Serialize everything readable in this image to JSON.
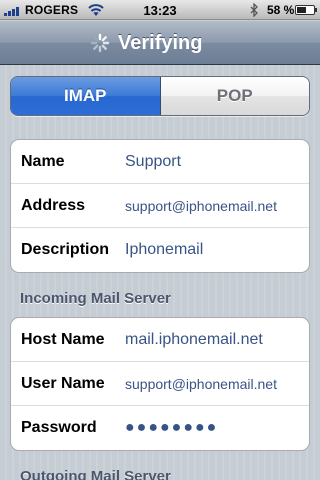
{
  "status_bar": {
    "carrier": "ROGERS",
    "time": "13:23",
    "battery_percent": "58 %",
    "battery_level": 0.58,
    "icons": [
      "signal-icon",
      "wifi-icon",
      "bluetooth-icon",
      "battery-icon"
    ]
  },
  "nav": {
    "title": "Verifying",
    "spinner_icon": "activity-spinner-icon"
  },
  "segmented": {
    "options": [
      "IMAP",
      "POP"
    ],
    "selected": "IMAP"
  },
  "account": {
    "rows": [
      {
        "label": "Name",
        "value": "Support"
      },
      {
        "label": "Address",
        "value": "support@iphonemail.net"
      },
      {
        "label": "Description",
        "value": "Iphonemail"
      }
    ]
  },
  "incoming": {
    "header": "Incoming Mail Server",
    "rows": [
      {
        "label": "Host Name",
        "value": "mail.iphonemail.net"
      },
      {
        "label": "User Name",
        "value": "support@iphonemail.net"
      },
      {
        "label": "Password",
        "value": "●●●●●●●●"
      }
    ]
  },
  "outgoing": {
    "header": "Outgoing Mail Server"
  },
  "colors": {
    "accent_blue": "#2c6dd6",
    "value_text": "#385487",
    "background": "#c5ccd4"
  }
}
